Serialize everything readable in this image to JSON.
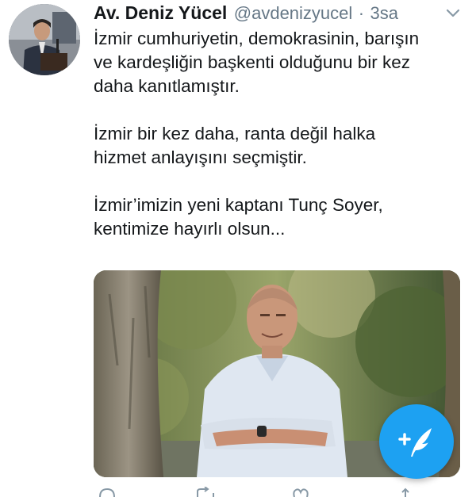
{
  "tweet": {
    "author_name": "Av. Deniz Yücel",
    "handle": "@avdenizyucel",
    "separator": "·",
    "time": "3sa",
    "paragraphs": [
      "İzmir cumhuriyetin, demokrasinin, barışın\nve kardeşliğin başkenti olduğunu bir kez\ndaha kanıtlamıştır.",
      "İzmir bir kez daha, ranta değil halka\nhizmet anlayışını seçmiştir.",
      "İzmir’imizin yeni kaptanı Tunç Soyer,\nkentimize hayırlı olsun..."
    ]
  },
  "icons": {
    "caret": "chevron-down-icon",
    "compose": "compose-tweet-icon",
    "reply": "reply-icon",
    "retweet": "retweet-icon",
    "like": "heart-icon",
    "share": "share-icon"
  },
  "colors": {
    "accent": "#1da1f2",
    "text": "#14171a",
    "secondary": "#657786"
  }
}
